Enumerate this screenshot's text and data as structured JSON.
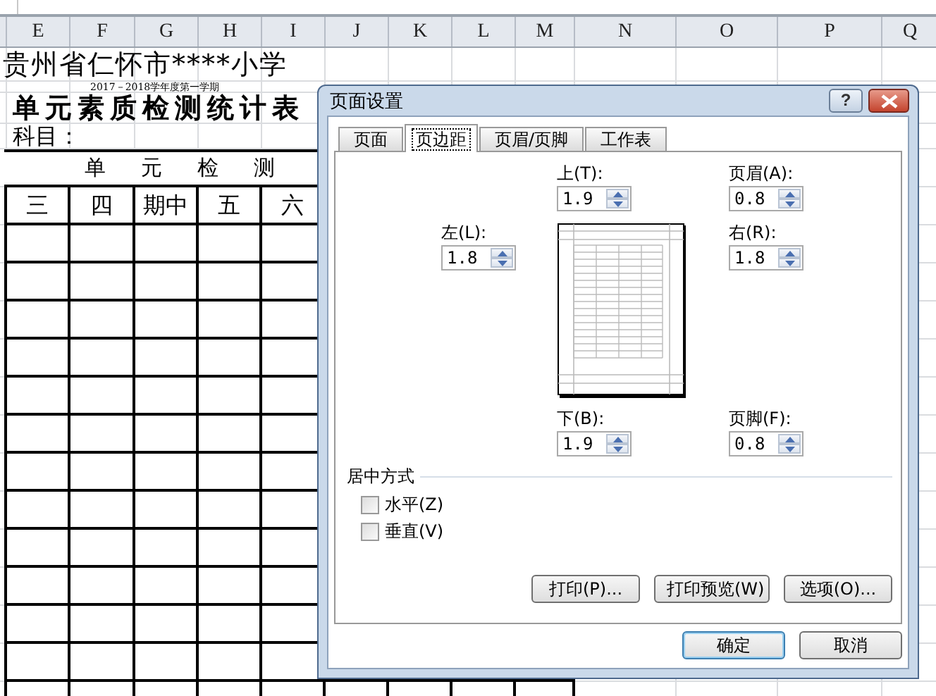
{
  "spreadsheet": {
    "column_headers": [
      "E",
      "F",
      "G",
      "H",
      "I",
      "J",
      "K",
      "L",
      "M",
      "N",
      "O",
      "P",
      "Q"
    ],
    "school": "贵州省仁怀市****小学",
    "term": "2017－2018学年度第一学期",
    "title": "单元素质检测统计表",
    "subject": "科目：",
    "section_title": "单元检测",
    "columns": [
      "三",
      "四",
      "期中",
      "五",
      "六"
    ]
  },
  "dialog": {
    "title": "页面设置",
    "help": "?",
    "tabs": [
      {
        "label": "页面",
        "selected": false
      },
      {
        "label": "页边距",
        "selected": true
      },
      {
        "label": "页眉/页脚",
        "selected": false
      },
      {
        "label": "工作表",
        "selected": false
      }
    ],
    "margins": [
      {
        "kind": "top",
        "label": "上(T):",
        "value": "1.9"
      },
      {
        "kind": "header",
        "label": "页眉(A):",
        "value": "0.8"
      },
      {
        "kind": "left",
        "label": "左(L):",
        "value": "1.8"
      },
      {
        "kind": "right",
        "label": "右(R):",
        "value": "1.8"
      },
      {
        "kind": "bottom",
        "label": "下(B):",
        "value": "1.9"
      },
      {
        "kind": "footer",
        "label": "页脚(F):",
        "value": "0.8"
      }
    ],
    "centering": {
      "label": "居中方式",
      "options": [
        {
          "label": "水平(Z)",
          "checked": false
        },
        {
          "label": "垂直(V)",
          "checked": false
        }
      ]
    },
    "actions": [
      "打印(P)...",
      "打印预览(W)",
      "选项(O)..."
    ],
    "buttons": [
      {
        "label": "确定",
        "default": true
      },
      {
        "label": "取消",
        "default": false
      }
    ]
  }
}
